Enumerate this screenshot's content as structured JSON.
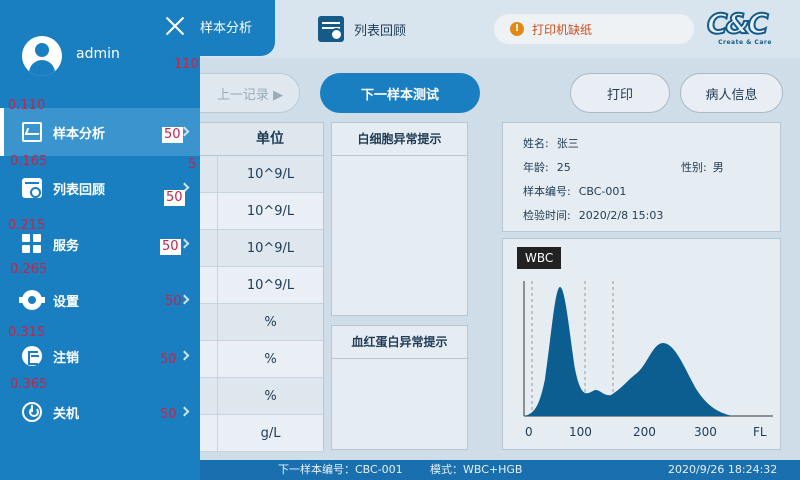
{
  "header": {
    "active_tab_label": "样本分析",
    "list_tab_label": "列表回顾",
    "printer_alert": "打印机缺纸",
    "logo_mark": "C&C",
    "logo_sub": "Create & Care"
  },
  "toolbar": {
    "prev_label": "上一记录 ▶",
    "next_label": "下一样本测试",
    "print_label": "打印",
    "patient_label": "病人信息"
  },
  "results": {
    "unit_header": "单位",
    "units": [
      "10^9/L",
      "10^9/L",
      "10^9/L",
      "10^9/L",
      "%",
      "%",
      "%",
      "g/L"
    ]
  },
  "alerts": {
    "wbc_title": "白细胞异常提示",
    "hgb_title": "血红蛋白异常提示"
  },
  "patient": {
    "name_label": "姓名:",
    "name": "张三",
    "age_label": "年龄:",
    "age": "25",
    "sex_label": "性别:",
    "sex": "男",
    "sample_label": "样本编号:",
    "sample": "CBC-001",
    "time_label": "检验时间:",
    "time": "2020/2/8 15:03"
  },
  "histogram": {
    "tag": "WBC",
    "x_ticks": [
      "0",
      "100",
      "200",
      "300",
      "FL"
    ],
    "fill": "#0b5e8f"
  },
  "status": {
    "next_sample": "下一样本编号：CBC-001",
    "mode": "模式：WBC+HGB",
    "datetime": "2020/9/26   18:24:32"
  },
  "drawer": {
    "user": "admin",
    "items": [
      {
        "label": "样本分析",
        "icon": "analysis-icon"
      },
      {
        "label": "列表回顾",
        "icon": "list-review-icon"
      },
      {
        "label": "服务",
        "icon": "grid-icon"
      },
      {
        "label": "设置",
        "icon": "gear-icon"
      },
      {
        "label": "注销",
        "icon": "logout-icon"
      },
      {
        "label": "关机",
        "icon": "power-icon"
      }
    ]
  },
  "debug": {
    "a": "110",
    "b": "0.110",
    "c": "50",
    "d": "0.165",
    "e": "5",
    "f": "50",
    "g": "0.215",
    "h": "50",
    "i": "0.265",
    "j": "50",
    "k": "0.315",
    "l": "50",
    "m": "0.365",
    "n": "50"
  }
}
